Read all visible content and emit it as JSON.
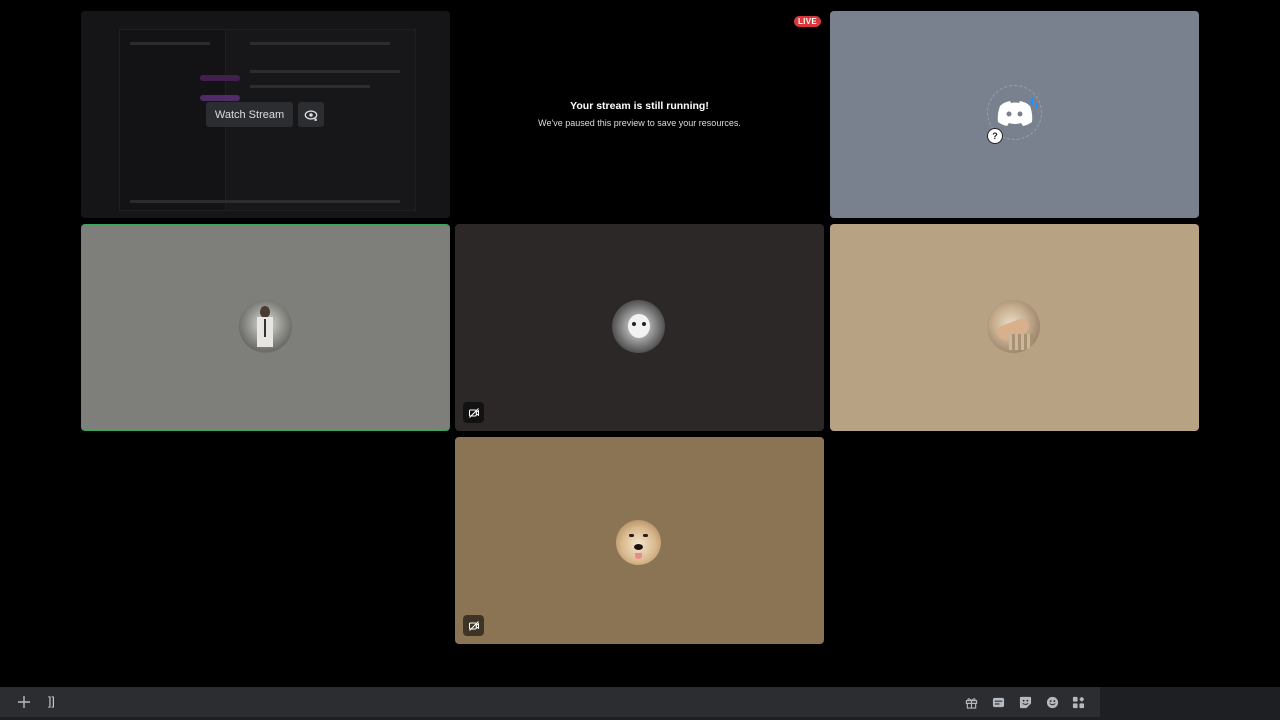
{
  "stream_tile": {
    "watch_label": "Watch Stream",
    "popout_icon": "popout-eye-icon"
  },
  "preview_notice": {
    "live_badge": "LIVE",
    "title": "Your stream is still running!",
    "subtitle": "We've paused this preview to save your resources."
  },
  "participants": [
    {
      "avatar": "discord-logo-avatar",
      "bg": "#79818f",
      "speaking": false,
      "video_off": false
    },
    {
      "avatar": "person-photo-avatar",
      "bg": "#7e7e7a",
      "speaking": true,
      "video_off": false
    },
    {
      "avatar": "cat-photo-avatar",
      "bg": "#2c2828",
      "speaking": false,
      "video_off": true
    },
    {
      "avatar": "hand-photo-avatar",
      "bg": "#b7a283",
      "speaking": false,
      "video_off": false
    },
    {
      "avatar": "dog-photo-avatar",
      "bg": "#8b7453",
      "speaking": false,
      "video_off": true
    }
  ],
  "chat_bar": {
    "typed_text": "]]",
    "icons": [
      "gift-icon",
      "gif-icon",
      "sticker-icon",
      "emoji-icon",
      "apps-icon"
    ]
  },
  "colors": {
    "live_red": "#da373c",
    "speaking_green": "#3ba55c"
  }
}
